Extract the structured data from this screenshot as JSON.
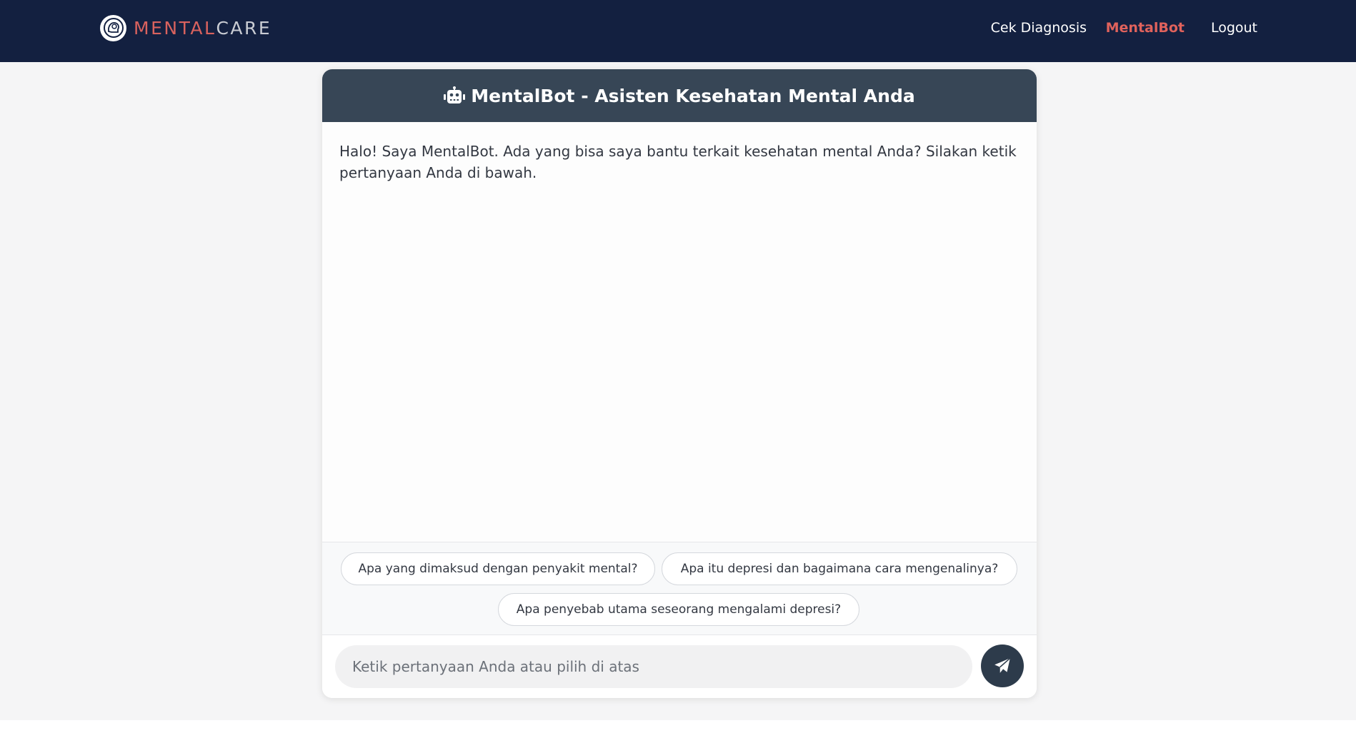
{
  "brand": {
    "name_part1": "MENTAL",
    "name_part2": "CARE",
    "logo_icon": "brain-head-icon"
  },
  "nav": {
    "items": [
      {
        "label": "Cek Diagnosis",
        "active": false
      },
      {
        "label": "MentalBot",
        "active": true
      },
      {
        "label": "Logout",
        "active": false
      }
    ]
  },
  "chat": {
    "header_icon": "robot-icon",
    "title": "MentalBot - Asisten Kesehatan Mental Anda",
    "messages": [
      {
        "sender": "bot",
        "text": "Halo! Saya MentalBot. Ada yang bisa saya bantu terkait kesehatan mental Anda? Silakan ketik pertanyaan Anda di bawah."
      }
    ],
    "suggestions": [
      "Apa yang dimaksud dengan penyakit mental?",
      "Apa itu depresi dan bagaimana cara mengenalinya?",
      "Apa penyebab utama seseorang mengalami depresi?"
    ],
    "input": {
      "value": "",
      "placeholder": "Ketik pertanyaan Anda atau pilih di atas"
    },
    "send_icon": "paper-plane-icon"
  },
  "colors": {
    "navbar": "#132040",
    "accent": "#e0625c",
    "chat_header": "#374656",
    "send_button": "#2d3b4b",
    "page_background": "#f5f5f6"
  }
}
